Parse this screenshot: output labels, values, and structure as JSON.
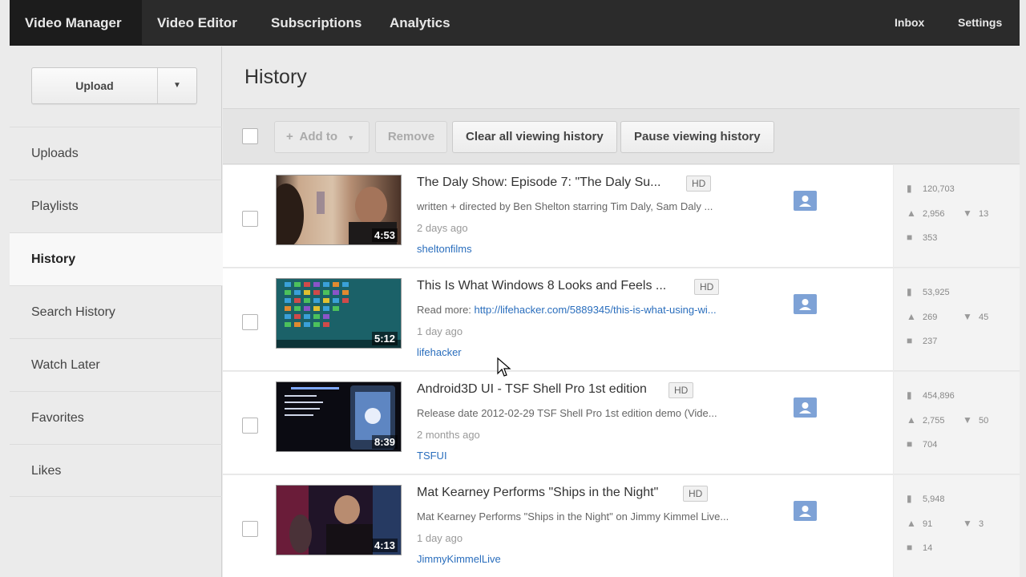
{
  "nav": {
    "tabs": [
      "Video Manager",
      "Video Editor",
      "Subscriptions",
      "Analytics"
    ],
    "inbox": "Inbox",
    "settings": "Settings"
  },
  "sidebar": {
    "upload_label": "Upload",
    "items": [
      "Uploads",
      "Playlists",
      "History",
      "Search History",
      "Watch Later",
      "Favorites",
      "Likes"
    ],
    "active": "History"
  },
  "page": {
    "title": "History"
  },
  "toolbar": {
    "add_to": "Add to",
    "remove": "Remove",
    "clear": "Clear all viewing history",
    "pause": "Pause viewing history"
  },
  "videos": [
    {
      "title": "The Daly Show: Episode 7: \"The Daly Su...",
      "badge": "HD",
      "desc": "written + directed by Ben Shelton starring Tim Daly, Sam Daly ...",
      "desc_link": "",
      "ago": "2 days ago",
      "channel": "sheltonfilms",
      "duration": "4:53",
      "views": "120,703",
      "likes": "2,956",
      "dislikes": "13",
      "comments": "353"
    },
    {
      "title": "This Is What Windows 8 Looks and Feels ...",
      "badge": "HD",
      "desc": "Read more: ",
      "desc_link": "http://lifehacker.com/5889345/this-is-what-using-wi...",
      "ago": "1 day ago",
      "channel": "lifehacker",
      "duration": "5:12",
      "views": "53,925",
      "likes": "269",
      "dislikes": "45",
      "comments": "237"
    },
    {
      "title": "Android3D UI - TSF Shell Pro 1st edition",
      "badge": "HD",
      "desc": "Release date 2012-02-29 TSF Shell Pro 1st edition demo (Vide...",
      "desc_link": "",
      "ago": "2 months ago",
      "channel": "TSFUI",
      "duration": "8:39",
      "views": "454,896",
      "likes": "2,755",
      "dislikes": "50",
      "comments": "704"
    },
    {
      "title": "Mat Kearney Performs \"Ships in the Night\"",
      "badge": "HD",
      "desc": "Mat Kearney Performs \"Ships in the Night\" on Jimmy Kimmel Live...",
      "desc_link": "",
      "ago": "1 day ago",
      "channel": "JimmyKimmelLive",
      "duration": "4:13",
      "views": "5,948",
      "likes": "91",
      "dislikes": "3",
      "comments": "14"
    }
  ]
}
